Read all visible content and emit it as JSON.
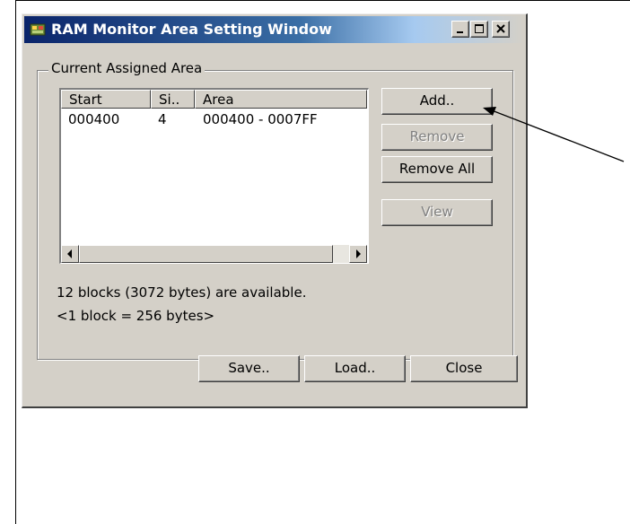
{
  "window": {
    "title": "RAM Monitor Area Setting Window",
    "title_bar_gradient_colors": [
      "#0a246a",
      "#3a6ea5",
      "#a6caf0"
    ],
    "face_color": "#d4d0c8",
    "caption_buttons": [
      "minimize-icon",
      "maximize-icon",
      "close-icon"
    ]
  },
  "group": {
    "legend": "Current Assigned Area"
  },
  "list": {
    "columns": [
      "Start",
      "Si..",
      "Area"
    ],
    "rows": [
      {
        "start": "000400",
        "size": "4",
        "area": "000400 - 0007FF"
      }
    ]
  },
  "buttons": {
    "add": "Add..",
    "remove": "Remove",
    "remove_all": "Remove All",
    "view": "View",
    "save": "Save..",
    "load": "Load..",
    "close": "Close"
  },
  "info": {
    "available": "12 blocks (3072 bytes) are available.",
    "block_size": "<1 block = 256 bytes>"
  }
}
